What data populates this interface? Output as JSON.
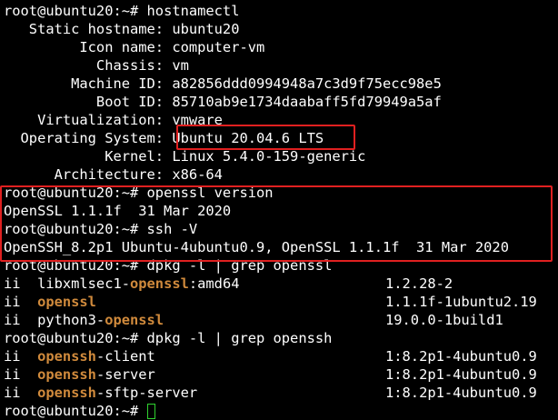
{
  "prompt": "root@ubuntu20:~# ",
  "cmd1": "hostnamectl",
  "info": [
    {
      "k": "   Static hostname: ",
      "v": "ubuntu20"
    },
    {
      "k": "         Icon name: ",
      "v": "computer-vm"
    },
    {
      "k": "           Chassis: ",
      "v": "vm"
    },
    {
      "k": "        Machine ID: ",
      "v": "a82856ddd0994948a7c3d9f75ecc98e5"
    },
    {
      "k": "           Boot ID: ",
      "v": "85710ab9e1734daabaff5fd79949a5af"
    },
    {
      "k": "    Virtualization: ",
      "v": "vmware"
    },
    {
      "k": "  Operating System: ",
      "v": "Ubuntu 20.04.6 LTS"
    },
    {
      "k": "            Kernel: ",
      "v": "Linux 5.4.0-159-generic"
    },
    {
      "k": "      Architecture: ",
      "v": "x86-64"
    }
  ],
  "cmd2": "openssl version",
  "out2": "OpenSSL 1.1.1f  31 Mar 2020",
  "cmd3": "ssh -V",
  "out3": "OpenSSH_8.2p1 Ubuntu-4ubuntu0.9, OpenSSL 1.1.1f  31 Mar 2020",
  "cmd4": "dpkg -l | grep openssl",
  "pkgs1": [
    {
      "pre": "ii  libxmlsec1-",
      "hl": "openssl",
      "post": ":amd64",
      "ver": "1.2.28-2"
    },
    {
      "pre": "ii  ",
      "hl": "openssl",
      "post": "",
      "ver": "1.1.1f-1ubuntu2.19"
    },
    {
      "pre": "ii  python3-",
      "hl": "openssl",
      "post": "",
      "ver": "19.0.0-1build1"
    }
  ],
  "cmd5": "dpkg -l | grep openssh",
  "pkgs2": [
    {
      "pre": "ii  ",
      "hl": "openssh",
      "post": "-client",
      "ver": "1:8.2p1-4ubuntu0.9"
    },
    {
      "pre": "ii  ",
      "hl": "openssh",
      "post": "-server",
      "ver": "1:8.2p1-4ubuntu0.9"
    },
    {
      "pre": "ii  ",
      "hl": "openssh",
      "post": "-sftp-server",
      "ver": "1:8.2p1-4ubuntu0.9"
    }
  ],
  "colors": {
    "background": "#000000",
    "text": "#ffffff",
    "match_highlight": "#d08a3c",
    "annotation_box": "#e02020",
    "cursor": "#2fd12f"
  }
}
